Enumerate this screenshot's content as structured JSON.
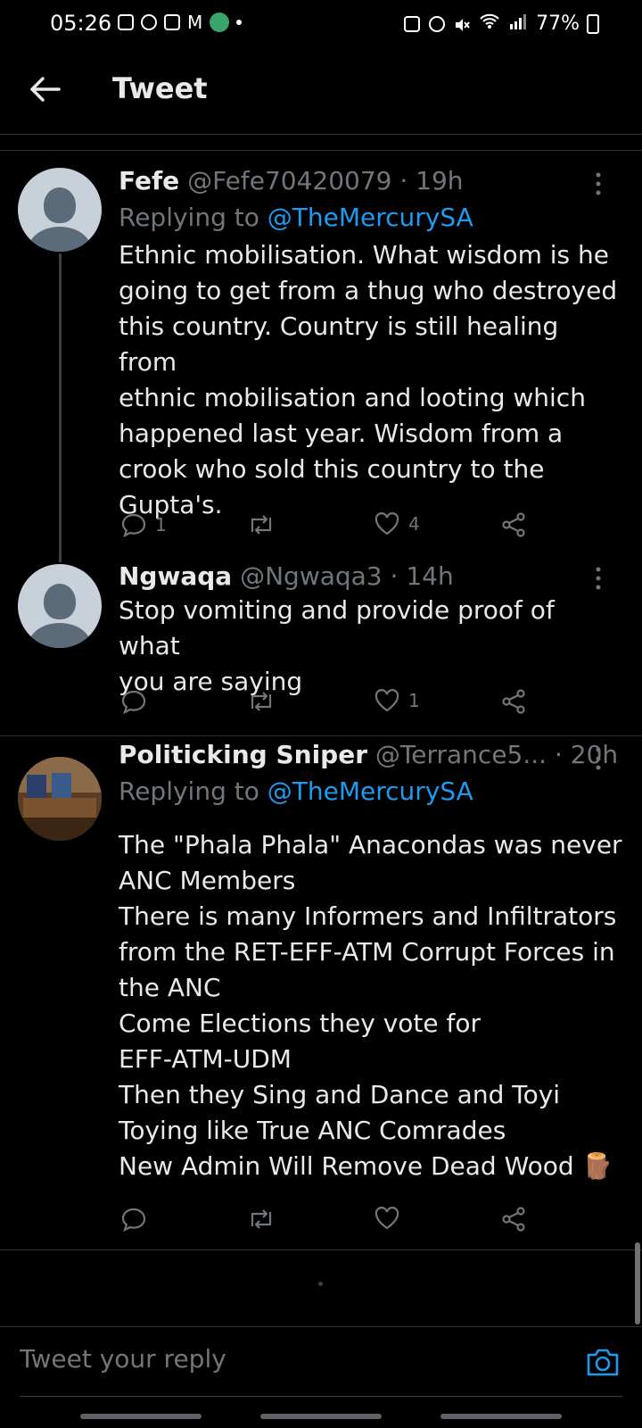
{
  "status_bar": {
    "time": "05:26",
    "battery": "77%"
  },
  "header": {
    "title": "Tweet"
  },
  "tweets": [
    {
      "name": "Fefe",
      "handle": "@Fefe70420079",
      "time": "· 19h",
      "replying_prefix": "Replying to ",
      "replying_to": "@TheMercurySA",
      "lines": [
        "Ethnic mobilisation. What wisdom is he",
        "going to get from a thug who destroyed",
        "this country. Country is still healing from",
        "ethnic mobilisation and looting which",
        "happened last year. Wisdom from a",
        "crook who sold this country to the",
        "Gupta's."
      ],
      "replies": "1",
      "retweets": "",
      "likes": "4"
    },
    {
      "name": "Ngwaqa",
      "handle": "@Ngwaqa3",
      "time": "· 14h",
      "lines": [
        "Stop vomiting and provide proof of what",
        "you are saying"
      ],
      "replies": "",
      "retweets": "",
      "likes": "1"
    },
    {
      "name": "Politicking Sniper",
      "handle": "@Terrance5...",
      "time": "· 20h",
      "replying_prefix": "Replying to ",
      "replying_to": "@TheMercurySA",
      "lines": [
        "The \"Phala Phala\" Anacondas was never",
        "ANC Members",
        "There is many Informers and Infiltrators",
        "from the RET-EFF-ATM Corrupt Forces in",
        "the ANC",
        "Come Elections they vote for",
        "EFF-ATM-UDM",
        "Then they Sing and Dance and Toyi",
        "Toying like True ANC Comrades",
        "New Admin Will Remove Dead Wood 🪵"
      ],
      "replies": "",
      "retweets": "",
      "likes": ""
    }
  ],
  "compose": {
    "placeholder": "Tweet your reply"
  },
  "colors": {
    "background": "#000000",
    "accent": "#1d9bf0",
    "muted": "#71767b",
    "text": "#e7e9ea"
  }
}
